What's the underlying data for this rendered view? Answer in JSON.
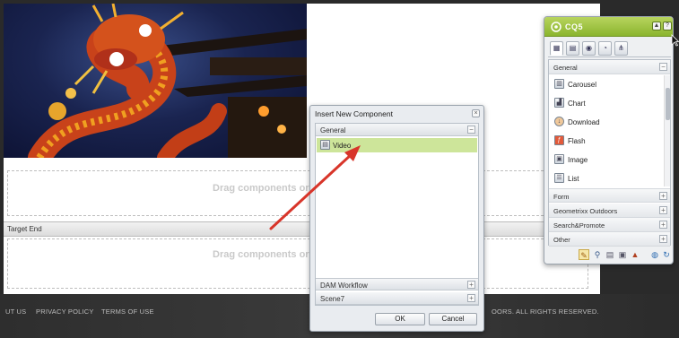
{
  "page": {
    "drop_text": "Drag components or",
    "target_end": "Target End",
    "footer_links": [
      "UT US",
      "PRIVACY POLICY",
      "TERMS OF USE"
    ],
    "footer_right": "OORS. ALL RIGHTS RESERVED."
  },
  "dialog": {
    "title": "Insert New Component",
    "close_glyph": "×",
    "groups": {
      "general": "General",
      "dam": "DAM Workflow",
      "scene7": "Scene7"
    },
    "selected_item": "Video",
    "ok_label": "OK",
    "cancel_label": "Cancel",
    "collapse_glyph": "−",
    "expand_glyph": "+"
  },
  "sidekick": {
    "title": "CQ5",
    "general_label": "General",
    "items": [
      "Carousel",
      "Chart",
      "Download",
      "Flash",
      "Image",
      "List"
    ],
    "groups": [
      "Form",
      "Geometrixx Outdoors",
      "Search&Promote",
      "Other"
    ],
    "collapse_glyph": "−",
    "expand_glyph": "+"
  },
  "colors": {
    "selection": "#cde59a",
    "sidekick_header": "#8bb52e",
    "arrow": "#d8352a"
  },
  "icons": {
    "sidekick_tabs": [
      "components-icon",
      "page-icon",
      "info-icon",
      "workflow-icon",
      "versioning-icon"
    ],
    "sidekick_tools": [
      "edit-icon",
      "search-icon",
      "page-properties-icon",
      "clientcontext-icon",
      "image-icon",
      "globe-icon",
      "refresh-icon"
    ]
  }
}
